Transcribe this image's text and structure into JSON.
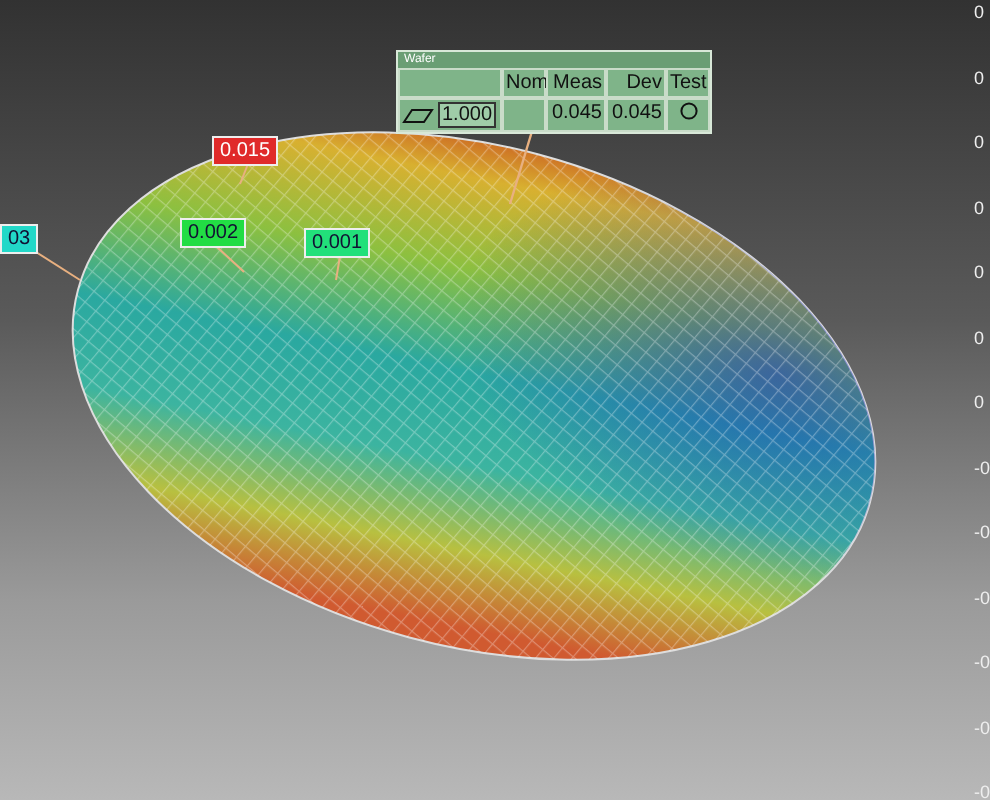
{
  "callout": {
    "title": "Wafer",
    "columns": [
      "Nom",
      "Meas",
      "Dev",
      "Test"
    ],
    "row": {
      "value": "1.000",
      "meas": "0.045",
      "dev": "0.045"
    }
  },
  "labels": [
    {
      "text": "0.015",
      "color": "#e02a2a"
    },
    {
      "text": "0.002",
      "color": "#22dd44"
    },
    {
      "text": "0.001",
      "color": "#22e07a"
    },
    {
      "text": "03",
      "color": "#22d8c8"
    }
  ],
  "scale_labels": [
    "0",
    "0",
    "0",
    "0",
    "0",
    "0",
    "0",
    "-0",
    "-0",
    "-0",
    "-0",
    "-0",
    "-0"
  ]
}
